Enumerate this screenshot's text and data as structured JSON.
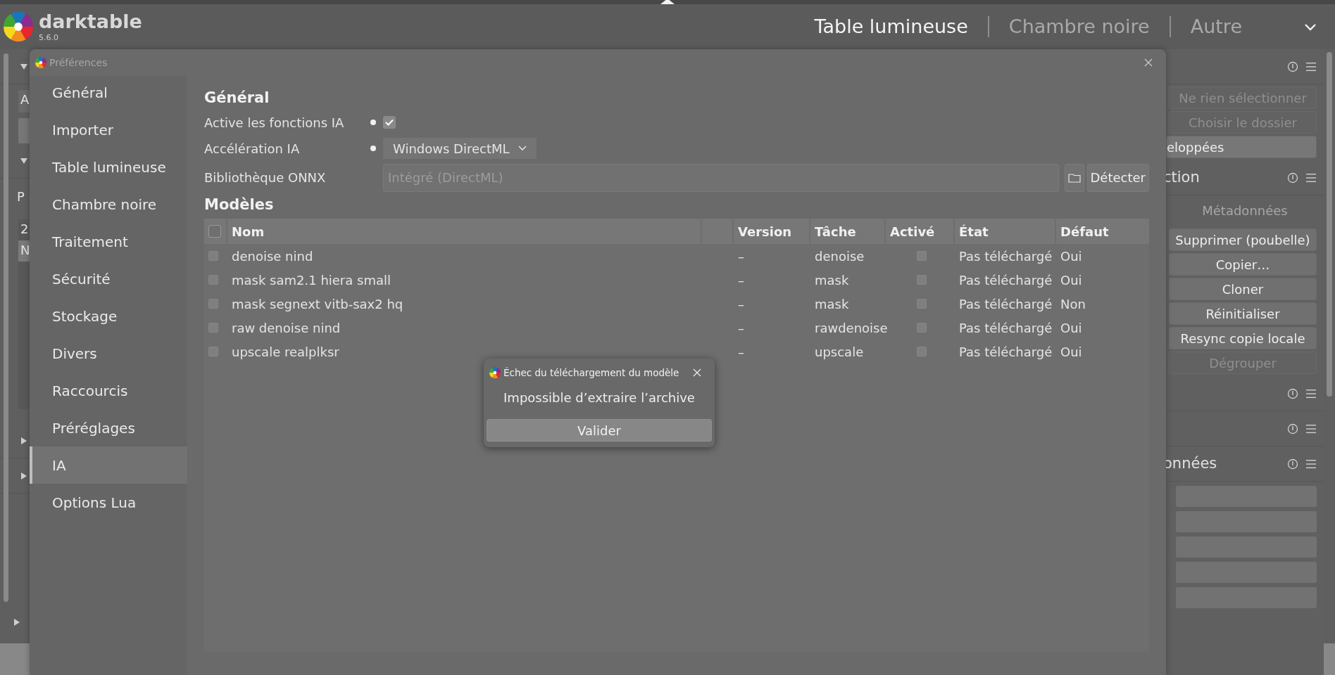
{
  "app": {
    "name": "darktable",
    "version": "5.6.0"
  },
  "views": [
    {
      "label": "Table lumineuse",
      "selected": true
    },
    {
      "label": "Chambre noire",
      "selected": false
    },
    {
      "label": "Autre",
      "selected": false
    }
  ],
  "left_panel": [
    {
      "kind": "header",
      "expanded": true
    },
    {
      "kind": "field",
      "text": "A"
    },
    {
      "kind": "block"
    },
    {
      "kind": "header",
      "expanded": true
    },
    {
      "kind": "label",
      "text": "P"
    },
    {
      "kind": "list",
      "rows": [
        {
          "text": "2",
          "selected": false
        },
        {
          "text": "N",
          "selected": true
        }
      ]
    },
    {
      "kind": "header",
      "expanded": false
    },
    {
      "kind": "header",
      "expanded": false
    }
  ],
  "right_panel": [
    {
      "kind": "header"
    },
    {
      "kind": "button",
      "label": "Ne rien sélectionner",
      "disabled": true
    },
    {
      "kind": "button",
      "label": "Choisir le dossier",
      "disabled": true
    },
    {
      "kind": "button",
      "label": "eloppées",
      "disabled": false
    },
    {
      "kind": "header",
      "label": "ction"
    },
    {
      "kind": "label",
      "label": "Métadonnées"
    },
    {
      "kind": "button",
      "label": "Supprimer (poubelle)",
      "disabled": false
    },
    {
      "kind": "button",
      "label": "Copier…",
      "disabled": false
    },
    {
      "kind": "button",
      "label": "Cloner",
      "disabled": false
    },
    {
      "kind": "button",
      "label": "Réinitialiser",
      "disabled": false
    },
    {
      "kind": "button",
      "label": "Resync copie locale",
      "disabled": false
    },
    {
      "kind": "button",
      "label": "Dégrouper",
      "disabled": true
    },
    {
      "kind": "header"
    },
    {
      "kind": "header"
    },
    {
      "kind": "header",
      "label": "onnées"
    },
    {
      "kind": "field"
    },
    {
      "kind": "field"
    },
    {
      "kind": "field"
    },
    {
      "kind": "field"
    },
    {
      "kind": "field"
    }
  ],
  "preferences": {
    "title": "Préférences",
    "tabs": [
      {
        "label": "Général",
        "selected": false
      },
      {
        "label": "Importer",
        "selected": false
      },
      {
        "label": "Table lumineuse",
        "selected": false
      },
      {
        "label": "Chambre noire",
        "selected": false
      },
      {
        "label": "Traitement",
        "selected": false
      },
      {
        "label": "Sécurité",
        "selected": false
      },
      {
        "label": "Stockage",
        "selected": false
      },
      {
        "label": "Divers",
        "selected": false
      },
      {
        "label": "Raccourcis",
        "selected": false
      },
      {
        "label": "Préréglages",
        "selected": false
      },
      {
        "label": "IA",
        "selected": true
      },
      {
        "label": "Options Lua",
        "selected": false
      }
    ],
    "general": {
      "heading": "Général",
      "settings": [
        {
          "kind": "checkbox",
          "label": "Active les fonctions IA",
          "modified": true,
          "checked": true
        },
        {
          "kind": "dropdown",
          "label": "Accélération IA",
          "modified": true,
          "value": "Windows DirectML"
        },
        {
          "kind": "path",
          "label": "Bibliothèque ONNX",
          "modified": false,
          "placeholder": "Intégré (DirectML)",
          "button": "Détecter"
        }
      ]
    },
    "models": {
      "heading": "Modèles",
      "select_all": false,
      "columns": [
        "Nom",
        "Version",
        "Tâche",
        "Activé",
        "État",
        "Défaut"
      ],
      "rows": [
        {
          "checked": false,
          "name": "denoise nind",
          "version": "–",
          "task": "denoise",
          "enabled": false,
          "status": "Pas téléchargé",
          "default": "Oui"
        },
        {
          "checked": false,
          "name": "mask sam2.1 hiera small",
          "version": "–",
          "task": "mask",
          "enabled": false,
          "status": "Pas téléchargé",
          "default": "Oui"
        },
        {
          "checked": false,
          "name": "mask segnext vitb-sax2 hq",
          "version": "–",
          "task": "mask",
          "enabled": false,
          "status": "Pas téléchargé",
          "default": "Non"
        },
        {
          "checked": false,
          "name": "raw denoise nind",
          "version": "–",
          "task": "rawdenoise",
          "enabled": false,
          "status": "Pas téléchargé",
          "default": "Oui"
        },
        {
          "checked": false,
          "name": "upscale realplksr",
          "version": "–",
          "task": "upscale",
          "enabled": false,
          "status": "Pas téléchargé",
          "default": "Oui"
        }
      ]
    }
  },
  "dialog": {
    "title": "Échec du téléchargement du modèle",
    "message": "Impossible d’extraire l’archive",
    "button": "Valider"
  }
}
